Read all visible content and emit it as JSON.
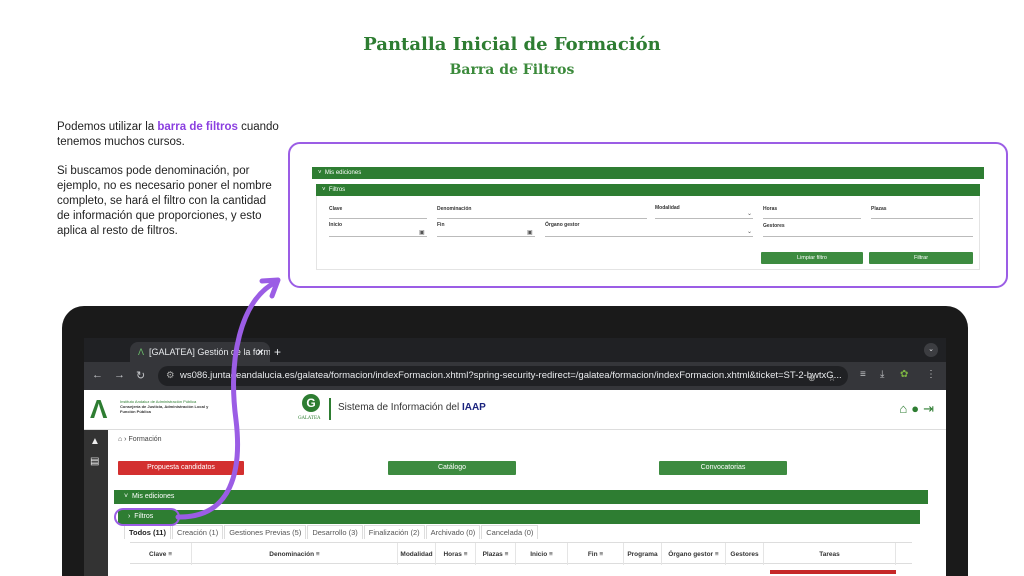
{
  "slide": {
    "title": "Pantalla Inicial de Formación",
    "subtitle": "Barra de Filtros",
    "explanation": {
      "p1_before": "Podemos utilizar la ",
      "p1_highlight": "barra de filtros",
      "p1_after": " cuando tenemos muchos cursos.",
      "p2": "Si buscamos pode denominación, por ejemplo, no es necesario poner el nombre completo, se hará el filtro con la  cantidad de información que proporciones, y esto aplica al resto de filtros."
    },
    "accent_color": "#9b5de5"
  },
  "zoom_panel": {
    "mis_ediciones": "Mis ediciones",
    "filtros": "Filtros",
    "labels": {
      "clave": "Clave",
      "denominacion": "Denominación",
      "modalidad": "Modalidad",
      "horas": "Horas",
      "plazas": "Plazas",
      "inicio": "Inicio",
      "fin": "Fin",
      "organo_gestor": "Órgano gestor",
      "gestores": "Gestores"
    },
    "limpiar_filtro": "Limpiar filtro",
    "filtrar": "Filtrar"
  },
  "browser": {
    "tab_title": "[GALATEA] Gestión de la form",
    "url": "ws086.juntadeandalucia.es/galatea/formacion/indexFormacion.xhtml?spring-security-redirect=/galatea/formacion/indexFormacion.xhtml&ticket=ST-2-bwtxG..."
  },
  "app": {
    "institution_line1": "Instituto Andaluz de Administración Pública",
    "institution_line2": "Consejería de Justicia, Administración Local y Función Pública",
    "galatea_logo_text": "GALATEA",
    "system_name_prefix": "Sistema de Información del ",
    "system_name_bold": "IAAP",
    "breadcrumb": "Formación",
    "buttons": {
      "propuesta": "Propuesta candidatos",
      "catalogo": "Catálogo",
      "convocatorias": "Convocatorias"
    },
    "mis_ediciones": "Mis ediciones",
    "filtros": "Filtros",
    "tabs": [
      "Todos (11)",
      "Creación (1)",
      "Gestiones Previas (5)",
      "Desarrollo (3)",
      "Finalización (2)",
      "Archivado (0)",
      "Cancelada (0)"
    ],
    "columns": [
      "Clave",
      "Denominación",
      "Modalidad",
      "Horas",
      "Plazas",
      "Inicio",
      "Fin",
      "Programa",
      "Órgano gestor",
      "Gestores",
      "Tareas"
    ],
    "colors": {
      "green": "#2e7d32",
      "button_green": "#3d8b40",
      "red": "#d32f2f"
    }
  }
}
